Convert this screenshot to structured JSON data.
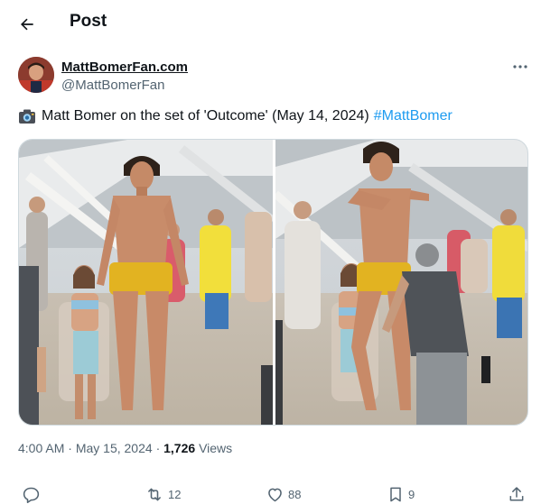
{
  "header": {
    "title": "Post"
  },
  "author": {
    "name": "MattBomerFan.com",
    "handle": "@MattBomerFan"
  },
  "tweet": {
    "text": "Matt Bomer on the set of 'Outcome' (May 14, 2024)",
    "hashtag": "#MattBomer"
  },
  "meta": {
    "time": "4:00 AM",
    "separator1": "·",
    "date": "May 15, 2024",
    "separator2": "·",
    "views_count": "1,726",
    "views_label": "Views"
  },
  "actions": {
    "reply_count": "",
    "retweet_count": "12",
    "like_count": "88",
    "bookmark_count": "9"
  },
  "icons": [
    "back-arrow-icon",
    "more-icon",
    "camera-icon",
    "reply-icon",
    "retweet-icon",
    "like-icon",
    "bookmark-icon",
    "share-icon"
  ],
  "colors": {
    "link": "#1d9bf0",
    "secondary_text": "#536471",
    "primary_text": "#0f1419",
    "swimsuit": "#e2b321"
  }
}
